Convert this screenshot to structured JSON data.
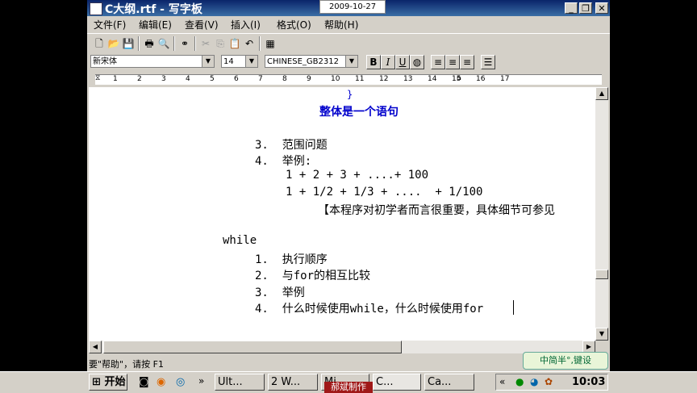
{
  "window": {
    "title": "C大纲.rtf - 写字板",
    "date": "2009-10-27"
  },
  "caption_buttons": {
    "minimize": "_",
    "maximize": "❐",
    "close": "✕"
  },
  "menu": [
    "文件(F)",
    "编辑(E)",
    "查看(V)",
    "插入(I)",
    "格式(O)",
    "帮助(H)"
  ],
  "format": {
    "font": "新宋体",
    "size": "14",
    "charset": "CHINESE_GB2312",
    "bold": "B",
    "italic": "I",
    "underline": "U"
  },
  "ruler": {
    "labels": [
      "1",
      "2",
      "3",
      "4",
      "5",
      "6",
      "7",
      "8",
      "9",
      "10",
      "11",
      "12",
      "13",
      "14",
      "15",
      "16",
      "17"
    ]
  },
  "document": {
    "lines": [
      {
        "text": "}",
        "blue": true
      },
      {
        "text": "整体是一个语句",
        "blue": true
      },
      {
        "text": "3.  范围问题"
      },
      {
        "text": "4.  举例:"
      },
      {
        "text": "1 + 2 + 3 + ....+ 100"
      },
      {
        "text": "1 + 1/2 + 1/3 + ....  + 1/100"
      },
      {
        "text": "【本程序对初学者而言很重要，具体细节可参见"
      },
      {
        "text": "while"
      },
      {
        "text": "1.  执行顺序"
      },
      {
        "text": "2.  与for的相互比较"
      },
      {
        "text": "3.  举例"
      },
      {
        "text": "4.  什么时候使用while，什么时候使用for"
      }
    ]
  },
  "status": {
    "text": "要\"帮助\"，请按 F1"
  },
  "ime": {
    "text": "中简半°,键设"
  },
  "taskbar": {
    "start": "开始",
    "tasks": [
      "Ult...",
      "2 W...",
      "Mi...",
      "C...",
      "Ca..."
    ],
    "watermark": "郝斌制作",
    "clock": "10:03"
  }
}
